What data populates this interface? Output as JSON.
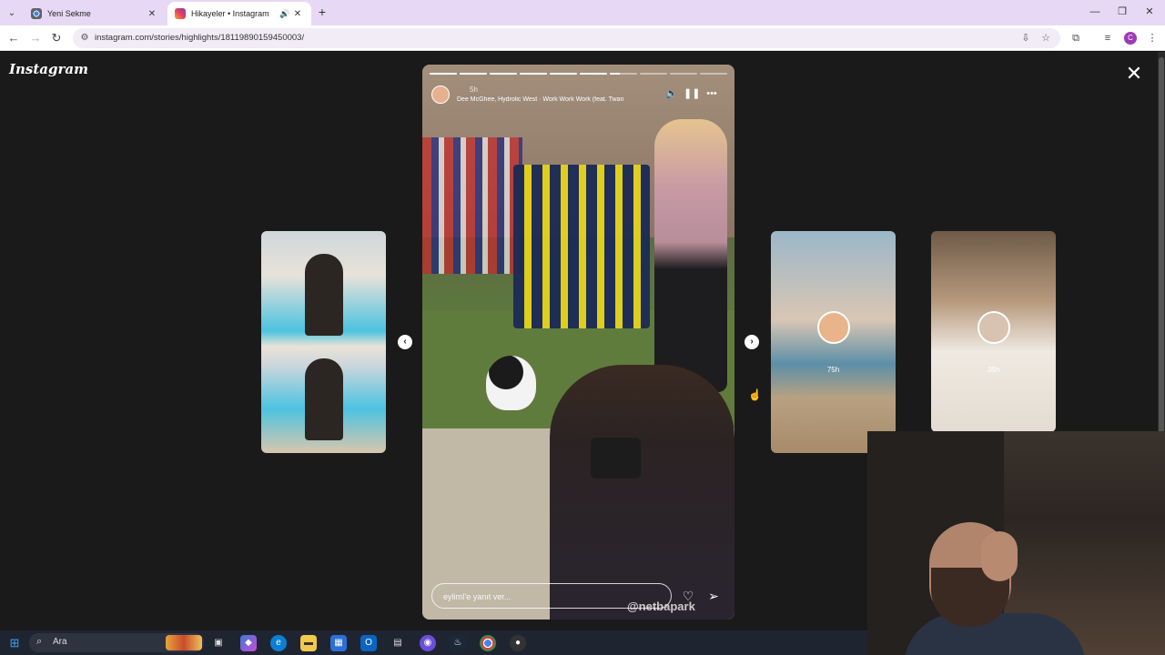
{
  "browser": {
    "tabs": [
      {
        "title": "Yeni Sekme",
        "active": false
      },
      {
        "title": "Hikayeler • Instagram",
        "active": true
      }
    ],
    "url": "instagram.com/stories/highlights/18119890159450003/"
  },
  "instagram": {
    "logo": "Instagram",
    "story": {
      "time": "5h",
      "music": "Dee McGhee, Hydrolic West · Work Work Work (feat. Twan",
      "reply_placeholder": "eylimI'e yanıt ver...",
      "watermark": "@netbapark",
      "progress": [
        1,
        1,
        1,
        1,
        1,
        1,
        0.35,
        0,
        0,
        0
      ]
    },
    "side_cards": [
      {
        "time": "75h"
      },
      {
        "time": "35h"
      }
    ]
  },
  "taskbar": {
    "search_label": "Ara"
  },
  "colors": {
    "tabbar_bg": "#e7d9f5",
    "ig_bg": "#1a1a1a",
    "taskbar_bg": "#1f2530"
  }
}
